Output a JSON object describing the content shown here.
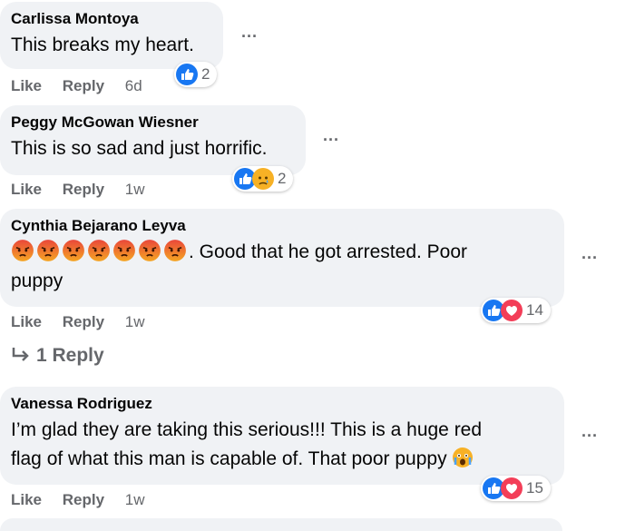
{
  "comments": [
    {
      "author": "Carlissa Montoya",
      "text": "This breaks my heart.",
      "like": "Like",
      "reply": "Reply",
      "time": "6d",
      "reaction_count": "2",
      "reactions": [
        "like"
      ]
    },
    {
      "author": "Peggy McGowan Wiesner",
      "text": "This is so sad and just horrific.",
      "like": "Like",
      "reply": "Reply",
      "time": "1w",
      "reaction_count": "2",
      "reactions": [
        "like",
        "sad"
      ]
    },
    {
      "author": "Cynthia Bejarano Leyva",
      "text_after_emoji": ". Good that he got arrested. Poor",
      "text_line2": "puppy",
      "emoji_count": 7,
      "emoji": "angry-face",
      "like": "Like",
      "reply": "Reply",
      "time": "1w",
      "reaction_count": "14",
      "reactions": [
        "like",
        "love"
      ]
    },
    {
      "author": "Vanessa Rodriguez",
      "text_line1": "I’m glad they are taking this serious!!! This is a huge red",
      "text_line2": "flag of what this man is capable of. That poor puppy",
      "like": "Like",
      "reply": "Reply",
      "time": "1w",
      "reaction_count": "15",
      "reactions": [
        "like",
        "love"
      ]
    }
  ],
  "view_replies": "1 Reply",
  "more_label": "···",
  "colors": {
    "bubble": "#f0f2f5",
    "secondary_text": "#65676b",
    "like_blue": "#1877f2",
    "love_red": "#f33e58"
  }
}
